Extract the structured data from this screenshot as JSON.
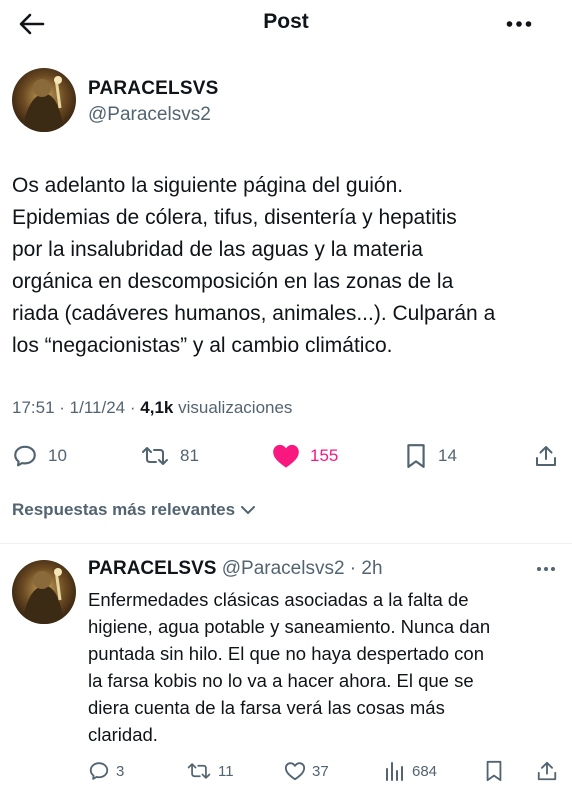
{
  "header": {
    "title": "Post",
    "back_icon": "arrow-left-icon",
    "more_icon": "more-horizontal-icon"
  },
  "tweet": {
    "author_name": "PARACELSVS",
    "author_handle": "@Paracelsvs2",
    "text_lines": [
      "Os adelanto la siguiente página del guión.",
      "Epidemias de cólera, tifus, disentería y hepatitis",
      "por la insalubridad de las aguas y la materia",
      "orgánica en descomposición en las zonas de la",
      "riada (cadáveres humanos, animales...). Culparán a",
      "los “negacionistas” y al cambio climático."
    ],
    "time": "17:51",
    "date": "1/11/24",
    "views_count": "4,1k",
    "views_label": "visualizaciones",
    "actions": {
      "replies": "10",
      "reposts": "81",
      "likes": "155",
      "bookmarks": "14"
    },
    "like_color": "#f91880"
  },
  "replies_filter": "Respuestas más relevantes",
  "reply": {
    "author_name": "PARACELSVS",
    "author_handle": "@Paracelsvs2",
    "time_ago": "2h",
    "text_lines": [
      "Enfermedades clásicas asociadas a la falta de",
      "higiene, agua potable y saneamiento. Nunca dan",
      "puntada sin hilo. El que no haya despertado con",
      "la farsa kobis no lo va a hacer ahora. El que se",
      "diera cuenta de la farsa verá las cosas más",
      "claridad."
    ],
    "actions": {
      "replies": "3",
      "reposts": "11",
      "likes": "37",
      "views": "684"
    }
  }
}
